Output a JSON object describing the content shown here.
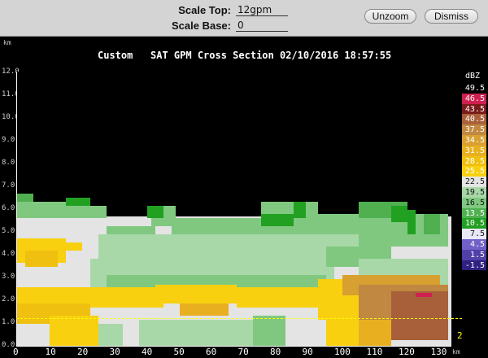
{
  "toolbar": {
    "scale_top_label": "Scale Top:",
    "scale_top_value": "12gpm",
    "scale_base_label": "Scale Base:",
    "scale_base_value": "0",
    "unzoom_label": "Unzoom",
    "dismiss_label": "Dismiss"
  },
  "plot": {
    "title": "Custom   SAT GPM Cross Section 02/10/2016 18:57:55",
    "y_unit": "km",
    "x_unit": "km",
    "y_ticks": [
      "12.0",
      "11.0",
      "10.0",
      "9.0",
      "8.0",
      "7.0",
      "6.0",
      "5.0",
      "4.0",
      "3.0",
      "2.0",
      "1.0",
      "0.0"
    ],
    "x_ticks": [
      "0",
      "10",
      "20",
      "30",
      "40",
      "50",
      "60",
      "70",
      "80",
      "90",
      "100",
      "110",
      "120",
      "130"
    ],
    "marker_text": "2"
  },
  "legend": {
    "unit": "dBZ",
    "entries": [
      {
        "label": "49.5",
        "bg": "#000000",
        "fg": "#ffffff"
      },
      {
        "label": "46.5",
        "bg": "#d02050",
        "fg": "#ffffff"
      },
      {
        "label": "43.5",
        "bg": "#7a1a1a",
        "fg": "#ffffff"
      },
      {
        "label": "40.5",
        "bg": "#a8603a",
        "fg": "#ffffff"
      },
      {
        "label": "37.5",
        "bg": "#c08840",
        "fg": "#ffffff"
      },
      {
        "label": "34.5",
        "bg": "#d8a030",
        "fg": "#ffffff"
      },
      {
        "label": "31.5",
        "bg": "#e8b020",
        "fg": "#ffffff"
      },
      {
        "label": "28.5",
        "bg": "#f0c010",
        "fg": "#ffffff"
      },
      {
        "label": "25.5",
        "bg": "#f8d010",
        "fg": "#ffffff"
      },
      {
        "label": "22.5",
        "bg": "#e4e4e4",
        "fg": "#111111"
      },
      {
        "label": "19.5",
        "bg": "#a8d8a8",
        "fg": "#111111"
      },
      {
        "label": "16.5",
        "bg": "#80c880",
        "fg": "#111111"
      },
      {
        "label": "13.5",
        "bg": "#50b050",
        "fg": "#ffffff"
      },
      {
        "label": "10.5",
        "bg": "#22a022",
        "fg": "#ffffff"
      },
      {
        "label": "7.5",
        "bg": "#e8e8f8",
        "fg": "#111111"
      },
      {
        "label": "4.5",
        "bg": "#7060c8",
        "fg": "#ffffff"
      },
      {
        "label": "1.5",
        "bg": "#5040a8",
        "fg": "#ffffff"
      },
      {
        "label": "-1.5",
        "bg": "#302080",
        "fg": "#ffffff"
      }
    ]
  }
}
